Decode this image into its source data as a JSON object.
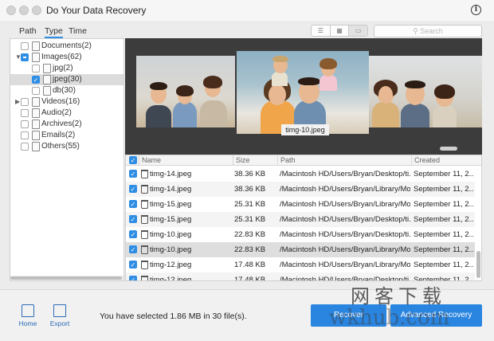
{
  "window": {
    "title": "Do Your Data Recovery"
  },
  "tabs": [
    {
      "label": "Path",
      "active": false
    },
    {
      "label": "Type",
      "active": true
    },
    {
      "label": "Time",
      "active": false
    }
  ],
  "search": {
    "placeholder": "Search"
  },
  "tree": [
    {
      "label": "Documents(2)",
      "icon": "document-icon",
      "checked": false,
      "expander": ""
    },
    {
      "label": "Images(62)",
      "icon": "image-icon",
      "checked": "partial",
      "expander": "expanded"
    },
    {
      "label": "jpg(2)",
      "icon": "file-icon",
      "checked": false,
      "expander": ""
    },
    {
      "label": "jpeg(30)",
      "icon": "file-icon",
      "checked": true,
      "expander": "",
      "selected": true
    },
    {
      "label": "db(30)",
      "icon": "file-icon",
      "checked": false,
      "expander": ""
    },
    {
      "label": "Videos(16)",
      "icon": "video-icon",
      "checked": false,
      "expander": "collapsed"
    },
    {
      "label": "Audio(2)",
      "icon": "audio-icon",
      "checked": false,
      "expander": ""
    },
    {
      "label": "Archives(2)",
      "icon": "archive-icon",
      "checked": false,
      "expander": ""
    },
    {
      "label": "Emails(2)",
      "icon": "email-icon",
      "checked": false,
      "expander": ""
    },
    {
      "label": "Others(55)",
      "icon": "other-file-icon",
      "checked": false,
      "expander": ""
    }
  ],
  "preview": {
    "caption": "timg-10.jpeg"
  },
  "table": {
    "columns": [
      "Name",
      "Size",
      "Path",
      "Created"
    ],
    "rows": [
      {
        "name": "timg-14.jpeg",
        "size": "38.36 KB",
        "path": "/Macintosh HD/Users/Bryan/Desktop/ti...",
        "created": "September 11, 2..."
      },
      {
        "name": "timg-14.jpeg",
        "size": "38.36 KB",
        "path": "/Macintosh HD/Users/Bryan/Library/Mo...",
        "created": "September 11, 2..."
      },
      {
        "name": "timg-15.jpeg",
        "size": "25.31 KB",
        "path": "/Macintosh HD/Users/Bryan/Library/Mo...",
        "created": "September 11, 2..."
      },
      {
        "name": "timg-15.jpeg",
        "size": "25.31 KB",
        "path": "/Macintosh HD/Users/Bryan/Desktop/ti...",
        "created": "September 11, 2..."
      },
      {
        "name": "timg-10.jpeg",
        "size": "22.83 KB",
        "path": "/Macintosh HD/Users/Bryan/Desktop/ti...",
        "created": "September 11, 2..."
      },
      {
        "name": "timg-10.jpeg",
        "size": "22.83 KB",
        "path": "/Macintosh HD/Users/Bryan/Library/Mo...",
        "created": "September 11, 2..."
      },
      {
        "name": "timg-12.jpeg",
        "size": "17.48 KB",
        "path": "/Macintosh HD/Users/Bryan/Library/Mo...",
        "created": "September 11, 2..."
      },
      {
        "name": "timg-12.jpeg",
        "size": "17.48 KB",
        "path": "/Macintosh HD/Users/Bryan/Desktop/ti...",
        "created": "September 11, 2..."
      }
    ]
  },
  "footer": {
    "home_label": "Home",
    "export_label": "Export",
    "status": "You have selected 1.86 MB in 30 file(s).",
    "recover_label": "Recover",
    "advanced_label": "Advanced Recovery"
  },
  "watermark": {
    "line1": "网客下载",
    "line2": "wkhub.com"
  },
  "colors": {
    "accent": "#2a85e0",
    "checkbox": "#2f8ee3"
  }
}
